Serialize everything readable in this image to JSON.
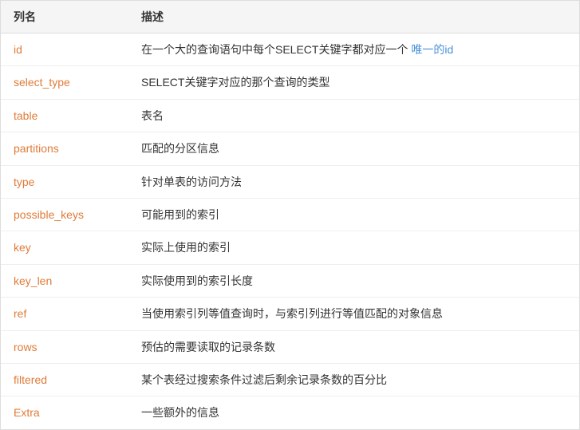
{
  "table": {
    "headers": {
      "col1": "列名",
      "col2": "描述"
    },
    "rows": [
      {
        "name": "id",
        "desc_plain": "在一个大的查询语句中每个SELECT关键字都对应一个",
        "desc_link": "唯一的id",
        "desc_suffix": ""
      },
      {
        "name": "select_type",
        "desc_plain": "SELECT关键字对应的那个查询的类型",
        "desc_link": "",
        "desc_suffix": ""
      },
      {
        "name": "table",
        "desc_plain": "表名",
        "desc_link": "",
        "desc_suffix": ""
      },
      {
        "name": "partitions",
        "desc_plain": "匹配的分区信息",
        "desc_link": "",
        "desc_suffix": ""
      },
      {
        "name": "type",
        "desc_plain": "针对单表的访问方法",
        "desc_link": "",
        "desc_suffix": ""
      },
      {
        "name": "possible_keys",
        "desc_plain": "可能用到的索引",
        "desc_link": "",
        "desc_suffix": ""
      },
      {
        "name": "key",
        "desc_plain": "实际上使用的索引",
        "desc_link": "",
        "desc_suffix": ""
      },
      {
        "name": "key_len",
        "desc_plain": "实际使用到的索引长度",
        "desc_link": "",
        "desc_suffix": ""
      },
      {
        "name": "ref",
        "desc_plain": "当使用索引列等值查询时，与索引列进行等值匹配的对象信息",
        "desc_link": "",
        "desc_suffix": ""
      },
      {
        "name": "rows",
        "desc_plain": "预估的需要读取的记录条数",
        "desc_link": "",
        "desc_suffix": ""
      },
      {
        "name": "filtered",
        "desc_plain": "某个表经过搜索条件过滤后剩余记录条数的百分比",
        "desc_link": "",
        "desc_suffix": ""
      },
      {
        "name": "Extra",
        "desc_plain": "一些额外的信息",
        "desc_link": "",
        "desc_suffix": ""
      }
    ]
  }
}
